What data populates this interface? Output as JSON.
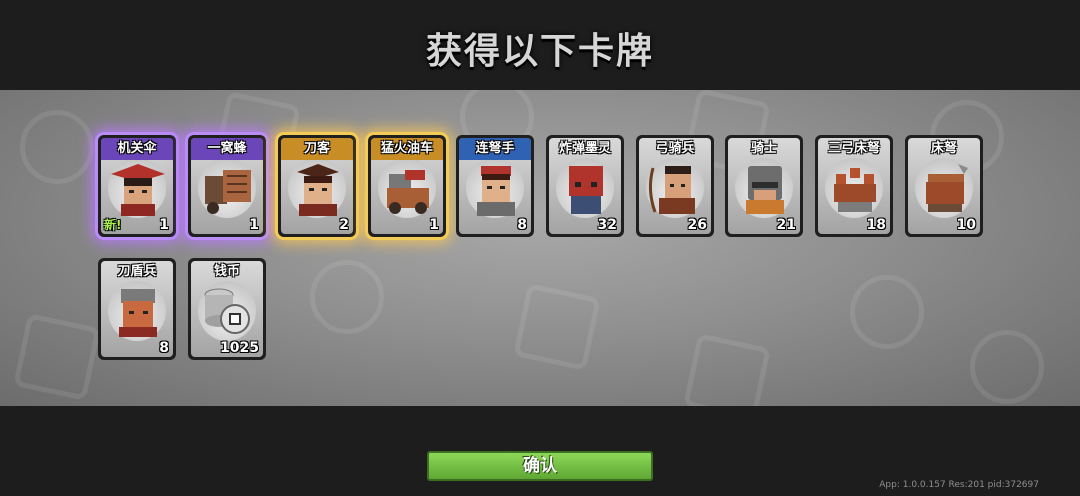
{
  "title": "获得以下卡牌",
  "cards": [
    {
      "name": "机关伞",
      "count": "1",
      "new_tag": "新!",
      "rarity": "purple"
    },
    {
      "name": "一窝蜂",
      "count": "1",
      "rarity": "purple"
    },
    {
      "name": "刀客",
      "count": "2",
      "rarity": "gold"
    },
    {
      "name": "猛火油车",
      "count": "1",
      "rarity": "gold"
    },
    {
      "name": "连弩手",
      "count": "8",
      "rarity": "blue"
    },
    {
      "name": "炸弹墨灵",
      "count": "32",
      "rarity": "common"
    },
    {
      "name": "弓骑兵",
      "count": "26",
      "rarity": "common"
    },
    {
      "name": "骑士",
      "count": "21",
      "rarity": "common"
    },
    {
      "name": "三弓床弩",
      "count": "18",
      "rarity": "common"
    },
    {
      "name": "床弩",
      "count": "10",
      "rarity": "common"
    },
    {
      "name": "刀盾兵",
      "count": "8",
      "rarity": "common"
    },
    {
      "name": "钱币",
      "count": "1025",
      "rarity": "common"
    }
  ],
  "confirm_label": "确认",
  "version_text": "App: 1.0.0.157 Res:201 pid:372697",
  "colors": {
    "purple_glow": "#b98cf7",
    "gold_glow": "#f3cc57",
    "blue_header": "#2f62b3",
    "confirm_green": "#6cbc40"
  }
}
